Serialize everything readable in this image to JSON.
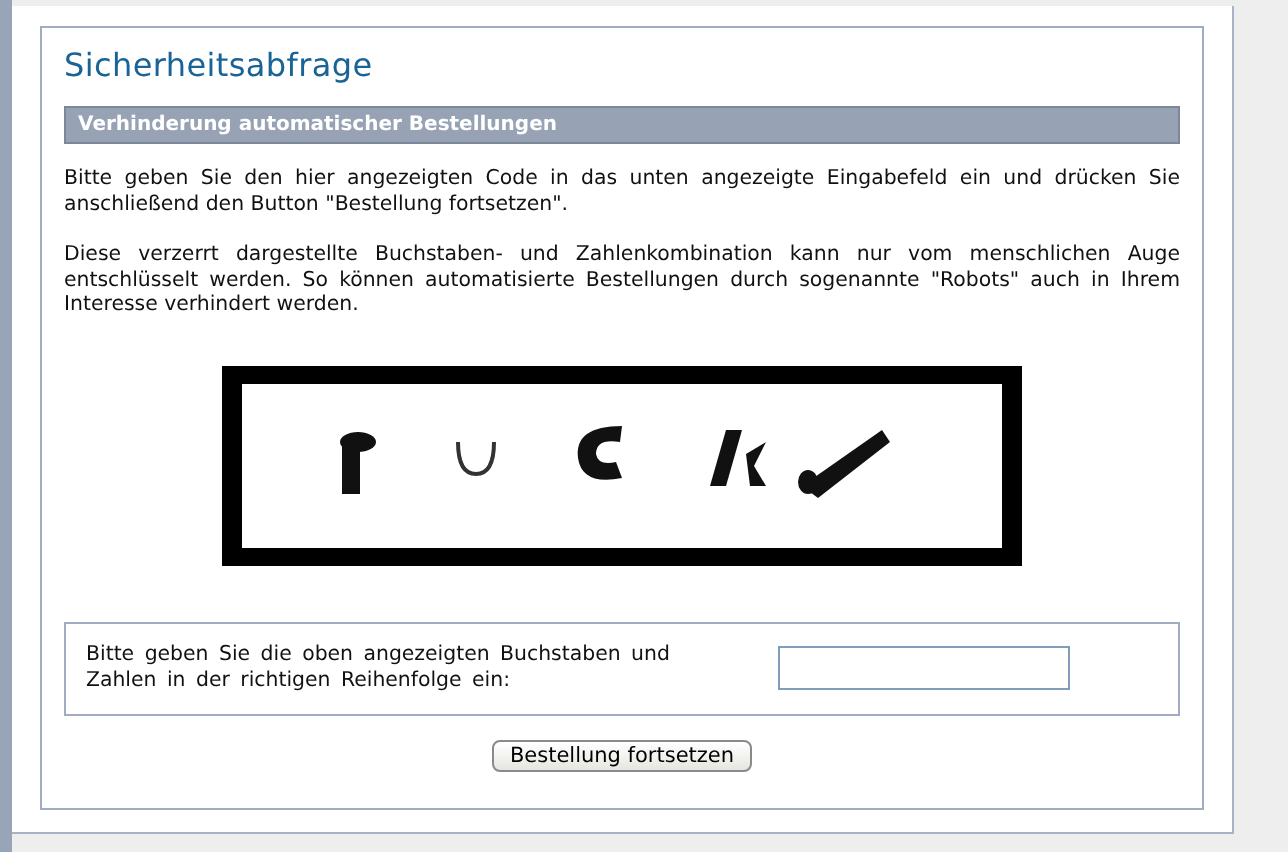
{
  "title": "Sicherheitsabfrage",
  "section": {
    "heading": "Verhinderung automatischer Bestellungen",
    "paragraphs": [
      "Bitte geben Sie den hier angezeigten Code in das unten angezeigte Eingabefeld ein und drücken Sie anschließend den Button \"Bestellung fortsetzen\".",
      "Diese verzerrt dargestellte Buchstaben- und Zahlenkombination kann nur vom menschlichen Auge entschlüsselt werden. So können automatisierte Bestellungen durch sogenannte \"Robots\" auch in Ihrem Interesse verhindert werden."
    ]
  },
  "entry": {
    "label": "Bitte geben Sie die oben angezeigten Buchstaben und Zahlen in der richtigen Reihenfolge ein:"
  },
  "button": "Bestellung fortsetzen"
}
